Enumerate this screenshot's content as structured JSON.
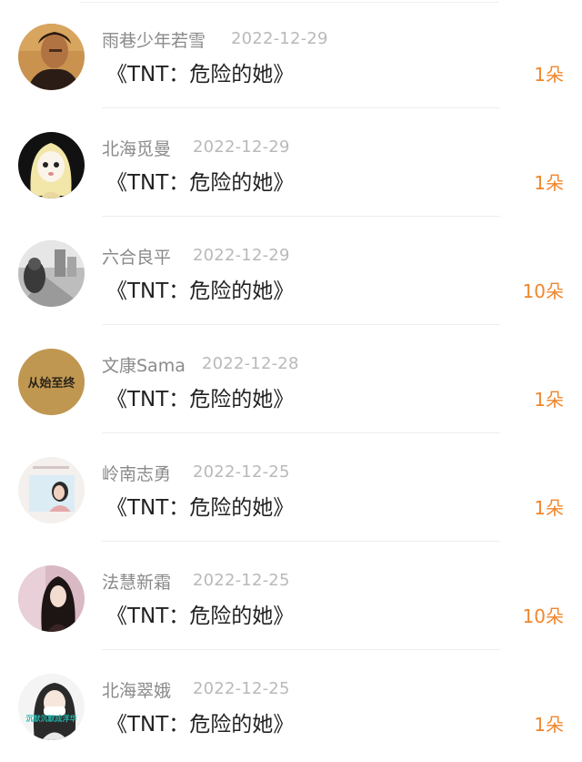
{
  "gifts": [
    {
      "user": "雨巷少年若雪",
      "date": "2022-12-29",
      "work": "《TNT：危险的她》",
      "amount": "1朵",
      "avatar": "portrait-man-icon"
    },
    {
      "user": "北海觅曼",
      "date": "2022-12-29",
      "work": "《TNT：危险的她》",
      "amount": "1朵",
      "avatar": "cartoon-girl-icon"
    },
    {
      "user": "六合良平",
      "date": "2022-12-29",
      "work": "《TNT：危险的她》",
      "amount": "10朵",
      "avatar": "street-photo-icon"
    },
    {
      "user": "文康Sama",
      "date": "2022-12-28",
      "work": "《TNT：危险的她》",
      "amount": "1朵",
      "avatar": "text-badge-icon",
      "avatar_text": "从始至终"
    },
    {
      "user": "岭南志勇",
      "date": "2022-12-25",
      "work": "《TNT：危险的她》",
      "amount": "1朵",
      "avatar": "girl-photo-icon"
    },
    {
      "user": "法慧新霜",
      "date": "2022-12-25",
      "work": "《TNT：危险的她》",
      "amount": "10朵",
      "avatar": "anime-girl-icon"
    },
    {
      "user": "北海翠娥",
      "date": "2022-12-25",
      "work": "《TNT：危险的她》",
      "amount": "1朵",
      "avatar": "mask-girl-icon",
      "avatar_text": "沉默沉默成浮华"
    }
  ],
  "colors": {
    "amount": "#f0862c",
    "name": "#8a8a8a",
    "date": "#b9b9b9",
    "title": "#222222"
  }
}
